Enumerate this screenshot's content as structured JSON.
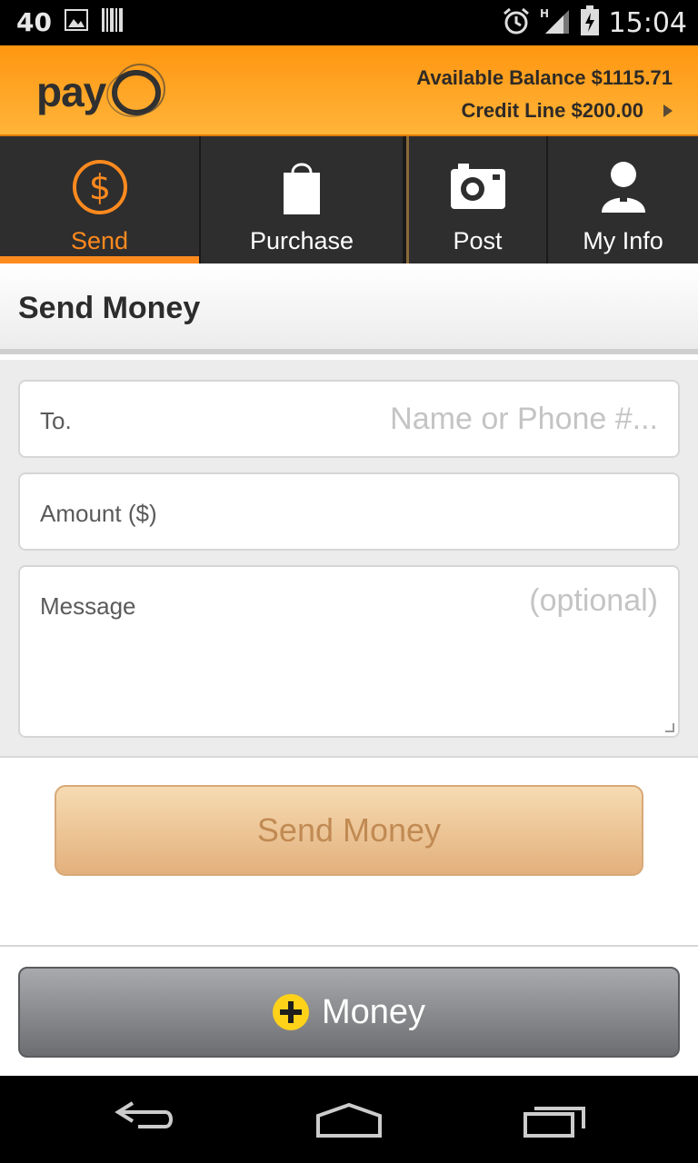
{
  "status_bar": {
    "notification_count": "40",
    "time": "15:04",
    "icons": [
      "image-icon",
      "barcode-icon",
      "alarm-icon",
      "signal-icon",
      "battery-icon"
    ]
  },
  "header": {
    "logo_text": "pay",
    "balance": "Available Balance $1115.71",
    "credit_line": "Credit Line $200.00",
    "accent": "#ff8a1e"
  },
  "tabs": [
    {
      "label": "Send",
      "icon": "dollar-icon",
      "active": true
    },
    {
      "label": "Purchase",
      "icon": "shopping-bag-icon",
      "active": false
    },
    {
      "label": "Post",
      "icon": "camera-icon",
      "active": false
    },
    {
      "label": "My Info",
      "icon": "user-icon",
      "active": false
    }
  ],
  "section": {
    "title": "Send Money"
  },
  "form": {
    "to_label": "To.",
    "to_placeholder": "Name or Phone #...",
    "amount_label": "Amount ($)",
    "message_label": "Message",
    "message_placeholder": "(optional)"
  },
  "actions": {
    "send_label": "Send Money",
    "add_money_label": "Money"
  },
  "nav": {
    "icons": [
      "back-icon",
      "home-icon",
      "recent-apps-icon"
    ]
  }
}
